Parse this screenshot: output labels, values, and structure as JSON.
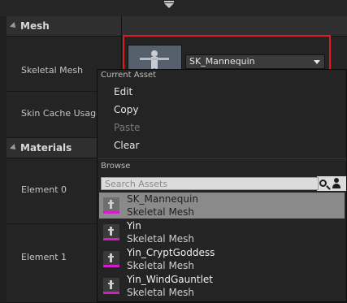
{
  "details": {
    "mesh_category": "Mesh",
    "materials_category": "Materials",
    "skeletal_mesh_label": "Skeletal Mesh",
    "skin_cache_label": "Skin Cache Usage",
    "element0_label": "Element 0",
    "element1_label": "Element 1",
    "selected_asset": "SK_Mannequin"
  },
  "menu": {
    "current_asset_header": "Current Asset",
    "items": [
      "Edit",
      "Copy",
      "Paste",
      "Clear"
    ],
    "disabled_items": [
      "Paste"
    ],
    "browse_header": "Browse",
    "search_placeholder": "Search Assets"
  },
  "assets": [
    {
      "name": "SK_Mannequin",
      "type": "Skeletal Mesh",
      "selected": true
    },
    {
      "name": "Yin",
      "type": "Skeletal Mesh",
      "selected": false
    },
    {
      "name": "Yin_CryptGoddess",
      "type": "Skeletal Mesh",
      "selected": false
    },
    {
      "name": "Yin_WindGauntlet",
      "type": "Skeletal Mesh",
      "selected": false
    }
  ],
  "colors": {
    "highlight_box": "#e01a24",
    "asset_type_bar": "#d21dcc",
    "selected_row": "#8a8a8a"
  }
}
